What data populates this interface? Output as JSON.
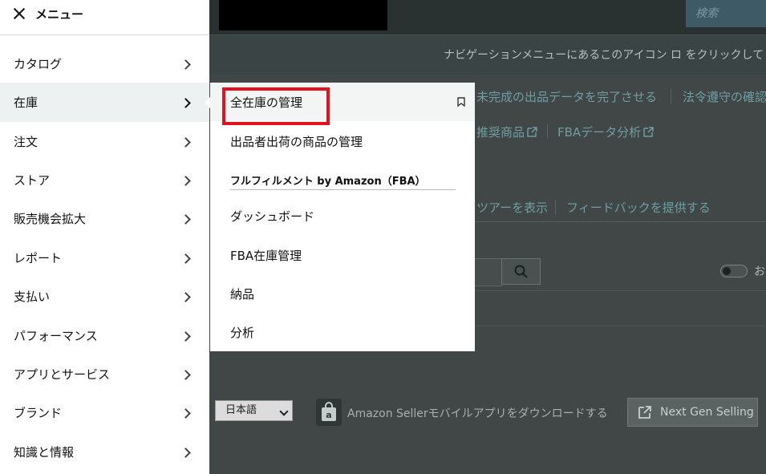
{
  "header": {
    "search_placeholder": "検索",
    "hint_text": "ナビゲーションメニューにあるこのアイコン ロ をクリックして"
  },
  "background": {
    "links_row1": [
      "未完成の出品データを完了させる",
      "法令遵守の確認"
    ],
    "links_row2": [
      "推奨商品",
      "FBAデータ分析"
    ],
    "links_row3": [
      "ツアーを表示",
      "フィードバックを提供する"
    ],
    "toggle_label": "お"
  },
  "footer": {
    "language": "日本語",
    "app_promo": "Amazon Sellerモバイルアプリをダウンロードする",
    "next_gen_button": "Next Gen Selling"
  },
  "menu": {
    "title": "メニュー",
    "items": [
      {
        "label": "カタログ"
      },
      {
        "label": "在庫"
      },
      {
        "label": "注文"
      },
      {
        "label": "ストア"
      },
      {
        "label": "販売機会拡大"
      },
      {
        "label": "レポート"
      },
      {
        "label": "支払い"
      },
      {
        "label": "パフォーマンス"
      },
      {
        "label": "アプリとサービス"
      },
      {
        "label": "ブランド"
      },
      {
        "label": "知識と情報"
      }
    ]
  },
  "submenu": {
    "items_top": [
      "全在庫の管理",
      "出品者出荷の商品の管理"
    ],
    "fba_header": "フルフィルメント by Amazon（FBA）",
    "items_fba": [
      "ダッシュボード",
      "FBA在庫管理",
      "納品",
      "分析"
    ]
  },
  "colors": {
    "highlight": "#e0121d",
    "link": "#6f9ea2"
  }
}
